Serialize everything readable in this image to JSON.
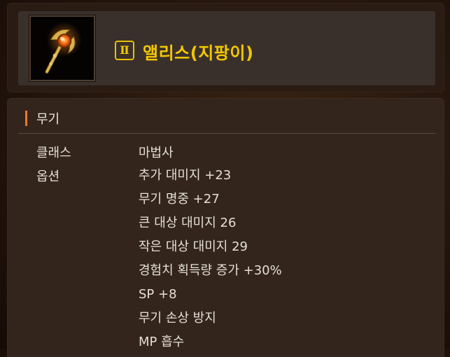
{
  "item": {
    "grade": "Ⅱ",
    "name": "앨리스(지팡이)",
    "icon": "magic-staff-icon"
  },
  "detail": {
    "category": "무기",
    "class_label": "클래스",
    "class_value": "마법사",
    "options_label": "옵션",
    "options": [
      "추가 대미지 +23",
      "무기 명중 +27",
      "큰 대상 대미지 26",
      "작은 대상 대미지 29",
      "경험치 획득량 증가 +30%",
      "SP +8",
      "무기 손상 방지",
      "MP 흡수"
    ]
  },
  "colors": {
    "item_name": "#f3c700",
    "accent_bar": "#e77a2f",
    "text": "#e6dfd6"
  }
}
